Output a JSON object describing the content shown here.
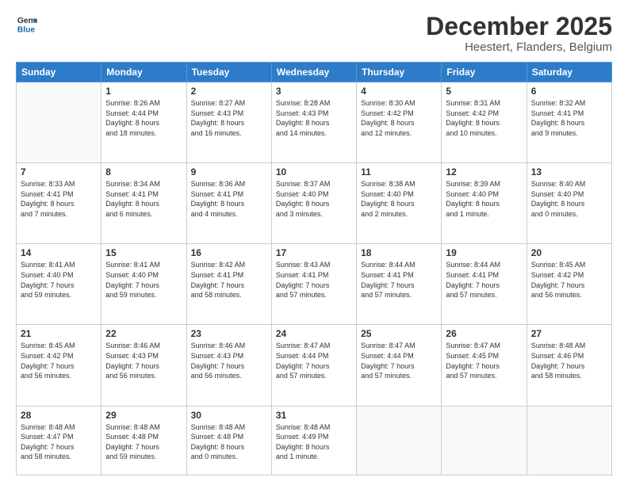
{
  "logo": {
    "line1": "General",
    "line2": "Blue"
  },
  "header": {
    "month": "December 2025",
    "location": "Heestert, Flanders, Belgium"
  },
  "weekdays": [
    "Sunday",
    "Monday",
    "Tuesday",
    "Wednesday",
    "Thursday",
    "Friday",
    "Saturday"
  ],
  "weeks": [
    [
      {
        "day": "",
        "info": ""
      },
      {
        "day": "1",
        "info": "Sunrise: 8:26 AM\nSunset: 4:44 PM\nDaylight: 8 hours\nand 18 minutes."
      },
      {
        "day": "2",
        "info": "Sunrise: 8:27 AM\nSunset: 4:43 PM\nDaylight: 8 hours\nand 16 minutes."
      },
      {
        "day": "3",
        "info": "Sunrise: 8:28 AM\nSunset: 4:43 PM\nDaylight: 8 hours\nand 14 minutes."
      },
      {
        "day": "4",
        "info": "Sunrise: 8:30 AM\nSunset: 4:42 PM\nDaylight: 8 hours\nand 12 minutes."
      },
      {
        "day": "5",
        "info": "Sunrise: 8:31 AM\nSunset: 4:42 PM\nDaylight: 8 hours\nand 10 minutes."
      },
      {
        "day": "6",
        "info": "Sunrise: 8:32 AM\nSunset: 4:41 PM\nDaylight: 8 hours\nand 9 minutes."
      }
    ],
    [
      {
        "day": "7",
        "info": "Sunrise: 8:33 AM\nSunset: 4:41 PM\nDaylight: 8 hours\nand 7 minutes."
      },
      {
        "day": "8",
        "info": "Sunrise: 8:34 AM\nSunset: 4:41 PM\nDaylight: 8 hours\nand 6 minutes."
      },
      {
        "day": "9",
        "info": "Sunrise: 8:36 AM\nSunset: 4:41 PM\nDaylight: 8 hours\nand 4 minutes."
      },
      {
        "day": "10",
        "info": "Sunrise: 8:37 AM\nSunset: 4:40 PM\nDaylight: 8 hours\nand 3 minutes."
      },
      {
        "day": "11",
        "info": "Sunrise: 8:38 AM\nSunset: 4:40 PM\nDaylight: 8 hours\nand 2 minutes."
      },
      {
        "day": "12",
        "info": "Sunrise: 8:39 AM\nSunset: 4:40 PM\nDaylight: 8 hours\nand 1 minute."
      },
      {
        "day": "13",
        "info": "Sunrise: 8:40 AM\nSunset: 4:40 PM\nDaylight: 8 hours\nand 0 minutes."
      }
    ],
    [
      {
        "day": "14",
        "info": "Sunrise: 8:41 AM\nSunset: 4:40 PM\nDaylight: 7 hours\nand 59 minutes."
      },
      {
        "day": "15",
        "info": "Sunrise: 8:41 AM\nSunset: 4:40 PM\nDaylight: 7 hours\nand 59 minutes."
      },
      {
        "day": "16",
        "info": "Sunrise: 8:42 AM\nSunset: 4:41 PM\nDaylight: 7 hours\nand 58 minutes."
      },
      {
        "day": "17",
        "info": "Sunrise: 8:43 AM\nSunset: 4:41 PM\nDaylight: 7 hours\nand 57 minutes."
      },
      {
        "day": "18",
        "info": "Sunrise: 8:44 AM\nSunset: 4:41 PM\nDaylight: 7 hours\nand 57 minutes."
      },
      {
        "day": "19",
        "info": "Sunrise: 8:44 AM\nSunset: 4:41 PM\nDaylight: 7 hours\nand 57 minutes."
      },
      {
        "day": "20",
        "info": "Sunrise: 8:45 AM\nSunset: 4:42 PM\nDaylight: 7 hours\nand 56 minutes."
      }
    ],
    [
      {
        "day": "21",
        "info": "Sunrise: 8:45 AM\nSunset: 4:42 PM\nDaylight: 7 hours\nand 56 minutes."
      },
      {
        "day": "22",
        "info": "Sunrise: 8:46 AM\nSunset: 4:43 PM\nDaylight: 7 hours\nand 56 minutes."
      },
      {
        "day": "23",
        "info": "Sunrise: 8:46 AM\nSunset: 4:43 PM\nDaylight: 7 hours\nand 56 minutes."
      },
      {
        "day": "24",
        "info": "Sunrise: 8:47 AM\nSunset: 4:44 PM\nDaylight: 7 hours\nand 57 minutes."
      },
      {
        "day": "25",
        "info": "Sunrise: 8:47 AM\nSunset: 4:44 PM\nDaylight: 7 hours\nand 57 minutes."
      },
      {
        "day": "26",
        "info": "Sunrise: 8:47 AM\nSunset: 4:45 PM\nDaylight: 7 hours\nand 57 minutes."
      },
      {
        "day": "27",
        "info": "Sunrise: 8:48 AM\nSunset: 4:46 PM\nDaylight: 7 hours\nand 58 minutes."
      }
    ],
    [
      {
        "day": "28",
        "info": "Sunrise: 8:48 AM\nSunset: 4:47 PM\nDaylight: 7 hours\nand 58 minutes."
      },
      {
        "day": "29",
        "info": "Sunrise: 8:48 AM\nSunset: 4:48 PM\nDaylight: 7 hours\nand 59 minutes."
      },
      {
        "day": "30",
        "info": "Sunrise: 8:48 AM\nSunset: 4:48 PM\nDaylight: 8 hours\nand 0 minutes."
      },
      {
        "day": "31",
        "info": "Sunrise: 8:48 AM\nSunset: 4:49 PM\nDaylight: 8 hours\nand 1 minute."
      },
      {
        "day": "",
        "info": ""
      },
      {
        "day": "",
        "info": ""
      },
      {
        "day": "",
        "info": ""
      }
    ]
  ]
}
